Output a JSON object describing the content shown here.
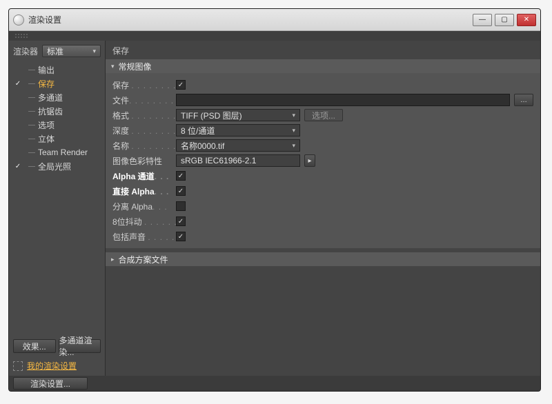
{
  "window": {
    "title": "渲染设置",
    "min": "—",
    "max": "▢",
    "close": "✕"
  },
  "sidebar": {
    "renderer_label": "渲染器",
    "renderer_value": "标准",
    "items": [
      {
        "label": "输出",
        "checked": null
      },
      {
        "label": "保存",
        "checked": true,
        "selected": true
      },
      {
        "label": "多通道",
        "checked": false
      },
      {
        "label": "抗锯齿",
        "checked": null
      },
      {
        "label": "选项",
        "checked": null
      },
      {
        "label": "立体",
        "checked": false
      },
      {
        "label": "Team Render",
        "checked": null
      },
      {
        "label": "全局光照",
        "checked": true
      }
    ],
    "btn_effects": "效果...",
    "btn_multipass": "多通道渲染...",
    "preset_label": "我的渲染设置"
  },
  "main": {
    "title": "保存",
    "section1": "常规图像",
    "section2": "合成方案文件",
    "options_btn": "选项...",
    "rows": {
      "save": {
        "label": "保存",
        "checked": true
      },
      "file": {
        "label": "文件",
        "value": ""
      },
      "format": {
        "label": "格式",
        "value": "TIFF (PSD 图层)"
      },
      "depth": {
        "label": "深度",
        "value": "8 位/通道"
      },
      "name": {
        "label": "名称",
        "value": "名称0000.tif"
      },
      "profile": {
        "label": "图像色彩特性",
        "value": "sRGB IEC61966-2.1"
      },
      "alpha": {
        "label": "Alpha 通道",
        "checked": true,
        "bold": true
      },
      "straight": {
        "label": "直接 Alpha",
        "checked": true,
        "bold": true
      },
      "separate": {
        "label": "分离 Alpha",
        "checked": false
      },
      "dither": {
        "label": "8位抖动",
        "checked": true
      },
      "sound": {
        "label": "包括声音",
        "checked": true
      }
    }
  },
  "status": {
    "render_settings": "渲染设置..."
  }
}
